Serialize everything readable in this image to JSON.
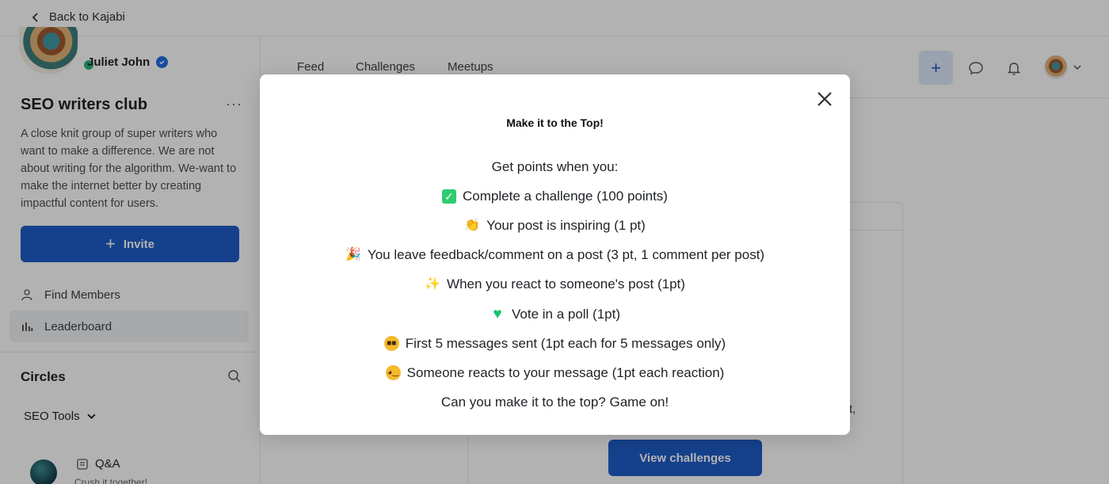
{
  "topbar": {
    "back_label": "Back to Kajabi"
  },
  "user": {
    "name": "Juliet John"
  },
  "group": {
    "title": "SEO writers club",
    "description": "A close knit group of super writers who want to make a difference. We are not about writing for the algorithm. We-want to make the internet better by creating impactful content for users.",
    "invite_label": "Invite"
  },
  "nav": [
    {
      "label": "Find Members",
      "icon": "person-icon"
    },
    {
      "label": "Leaderboard",
      "icon": "bar-chart-icon"
    }
  ],
  "circles": {
    "title": "Circles",
    "filter_label": "SEO Tools",
    "items": [
      {
        "name": "Q&A",
        "subtitle": "Crush it together!"
      }
    ]
  },
  "header": {
    "tabs": [
      "Feed",
      "Challenges",
      "Meetups"
    ],
    "plus_label": "+"
  },
  "content": {
    "peek_text": "t,",
    "view_challenges_label": "View challenges"
  },
  "modal": {
    "title": "Make it to the Top!",
    "lines": [
      {
        "emoji": "",
        "text": "Get points when you:"
      },
      {
        "emoji": "check",
        "text": "Complete a challenge (100 points)"
      },
      {
        "emoji": "👏",
        "text": "Your post is inspiring (1 pt)"
      },
      {
        "emoji": "🎉",
        "text": "You leave feedback/comment on a post (3 pt, 1 comment per post)"
      },
      {
        "emoji": "✨",
        "text": "When you react to someone's post (1pt)"
      },
      {
        "emoji": "heart",
        "text": "Vote in a poll (1pt)"
      },
      {
        "emoji": "sunglasses",
        "text": "First 5 messages sent (1pt each for 5 messages only)"
      },
      {
        "emoji": "wink",
        "text": "Someone reacts to your message (1pt each reaction)"
      },
      {
        "emoji": "",
        "text": "Can you make it to the top? Game on!"
      }
    ]
  },
  "colors": {
    "primary": "#1f5cc9",
    "online": "#2fb37a",
    "verified": "#1f6fe0",
    "check": "#2ecc71",
    "heart": "#19c26a"
  }
}
